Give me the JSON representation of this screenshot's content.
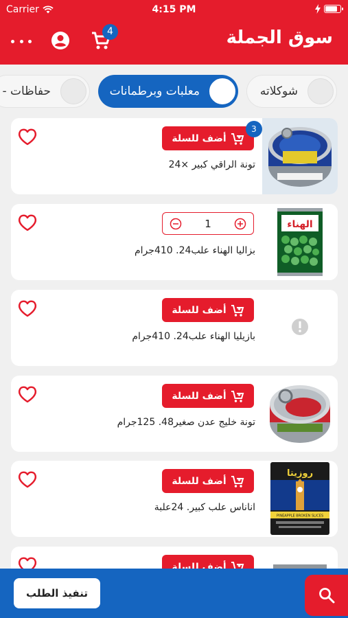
{
  "status_bar": {
    "carrier": "Carrier",
    "time": "4:15 PM"
  },
  "app_bar": {
    "title": "سوق الجملة",
    "cart_count": "4"
  },
  "categories": [
    {
      "label": "شوكلاته",
      "active": false
    },
    {
      "label": "معلبات وبرطمانات",
      "active": true
    },
    {
      "label": "حفاظات -",
      "active": false
    }
  ],
  "products": [
    {
      "name": "تونة الراقي كبير ×24",
      "action": "add",
      "add_label": "أضف للسلة",
      "cart_qty": "3"
    },
    {
      "name": "بزاليا الهناء علب24. 410جرام",
      "action": "stepper",
      "quantity": "1"
    },
    {
      "name": "بازيليا الهناء علب24. 410جرام",
      "action": "add",
      "add_label": "أضف للسلة",
      "image_missing": true
    },
    {
      "name": "تونة خليج عدن صغير48. 125جرام",
      "action": "add",
      "add_label": "أضف للسلة"
    },
    {
      "name": "اناناس علب كبير. 24علبة",
      "action": "add",
      "add_label": "أضف للسلة"
    },
    {
      "name": "",
      "action": "add",
      "add_label": "أضف للسلة"
    }
  ],
  "product_image_text": {
    "al_hana": "الهناء",
    "rozita": "روزيتا",
    "pineapple": "PINEAPPLE BROKEN SLICES"
  },
  "footer": {
    "checkout_label": "تنفيذ الطلب"
  },
  "colors": {
    "primary_red": "#e51c2c",
    "primary_blue": "#1565c0",
    "background": "#f0f0f0"
  }
}
